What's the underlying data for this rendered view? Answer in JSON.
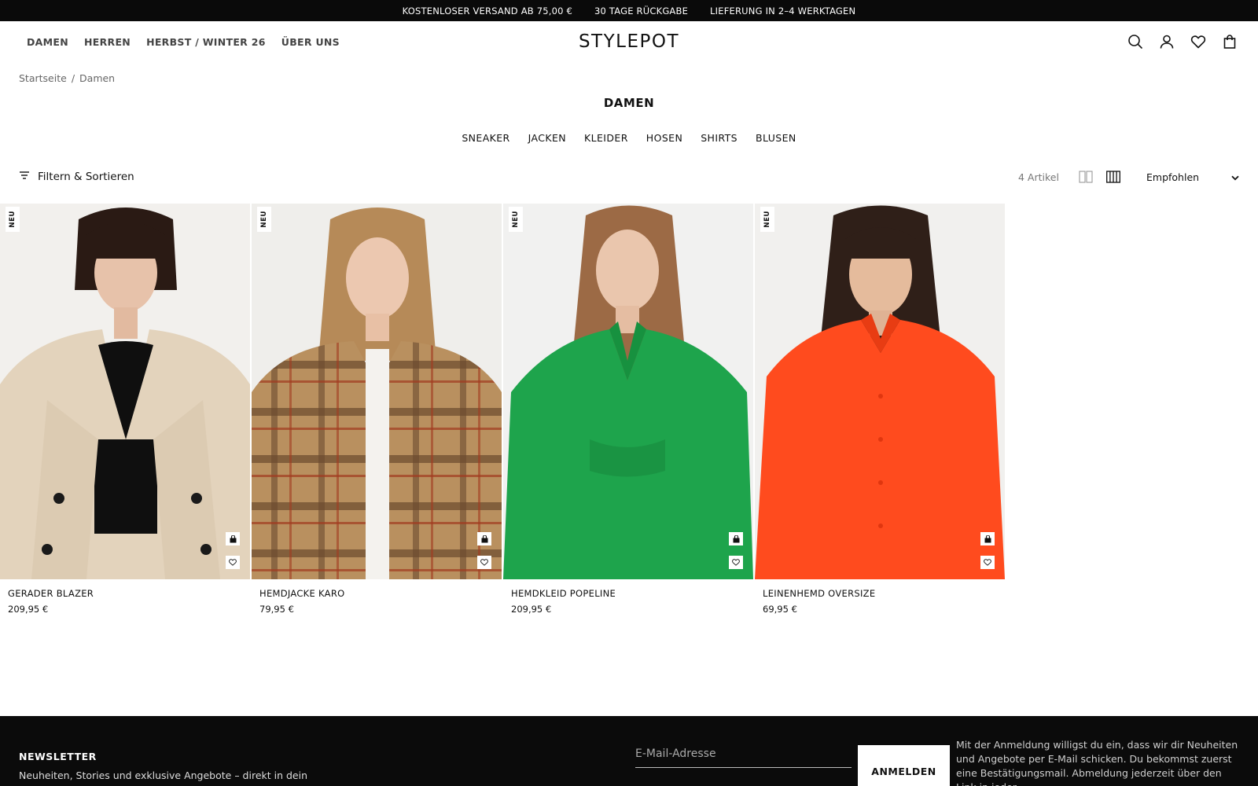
{
  "announcement": [
    "KOSTENLOSER VERSAND AB 75,00 €",
    "30 TAGE RÜCKGABE",
    "LIEFERUNG IN 2–4 WERKTAGEN"
  ],
  "header": {
    "nav": [
      "DAMEN",
      "HERREN",
      "HERBST / WINTER 26",
      "ÜBER UNS"
    ],
    "logo": "STYLEPOT",
    "icons": [
      "search-icon",
      "account-icon",
      "wishlist-icon",
      "bag-icon"
    ]
  },
  "breadcrumb": {
    "home": "Startseite",
    "separator": "/",
    "current": "Damen"
  },
  "page": {
    "title": "DAMEN"
  },
  "categories": [
    "SNEAKER",
    "JACKEN",
    "KLEIDER",
    "HOSEN",
    "SHIRTS",
    "BLUSEN"
  ],
  "toolbar": {
    "filter_label": "Filtern & Sortieren",
    "count": "4 Artikel",
    "sort_value": "Empfohlen"
  },
  "badge_label": "NEU",
  "products": [
    {
      "name": "GERADER BLAZER",
      "price": "209,95 €",
      "color": "#e6d6c0"
    },
    {
      "name": "HEMDJACKE KARO",
      "price": "79,95 €",
      "color": "#b58a5c"
    },
    {
      "name": "HEMDKLEID POPELINE",
      "price": "209,95 €",
      "color": "#1aa34a"
    },
    {
      "name": "LEINENHEMD OVERSIZE",
      "price": "69,95 €",
      "color": "#ff4a1c"
    }
  ],
  "newsletter": {
    "title": "NEWSLETTER",
    "subtitle": "Neuheiten, Stories und exklusive Angebote – direkt in dein",
    "email_placeholder": "E-Mail-Adresse",
    "button": "ANMELDEN",
    "legal": "Mit der Anmeldung willigst du ein, dass wir dir Neuheiten und Angebote per E-Mail schicken. Du bekommst zuerst eine Bestätigungsmail. Abmeldung jederzeit über den Link in jeder"
  }
}
